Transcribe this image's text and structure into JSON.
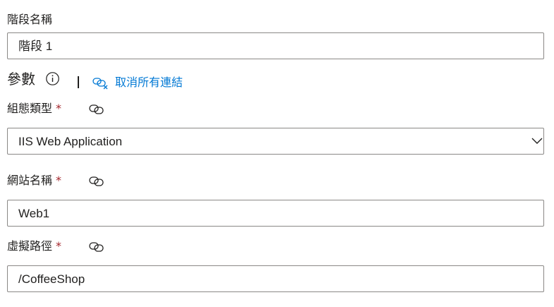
{
  "stage": {
    "label": "階段名稱",
    "value": "階段 1"
  },
  "parameters": {
    "title": "參數",
    "unlink_all_label": "取消所有連結"
  },
  "config_type": {
    "label": "組態類型",
    "required_mark": "*",
    "value": "IIS Web Application"
  },
  "site_name": {
    "label": "網站名稱",
    "required_mark": "*",
    "value": "Web1"
  },
  "virtual_path": {
    "label": "虛擬路徑",
    "required_mark": "*",
    "value": "/CoffeeShop"
  },
  "icons": {
    "info": "info-icon",
    "link": "link-icon",
    "unlink": "unlink-icon",
    "dropdown": "chevron-down-icon"
  },
  "colors": {
    "link_blue": "#0078d4",
    "required_red": "#a4262c",
    "border": "#8a8886"
  }
}
